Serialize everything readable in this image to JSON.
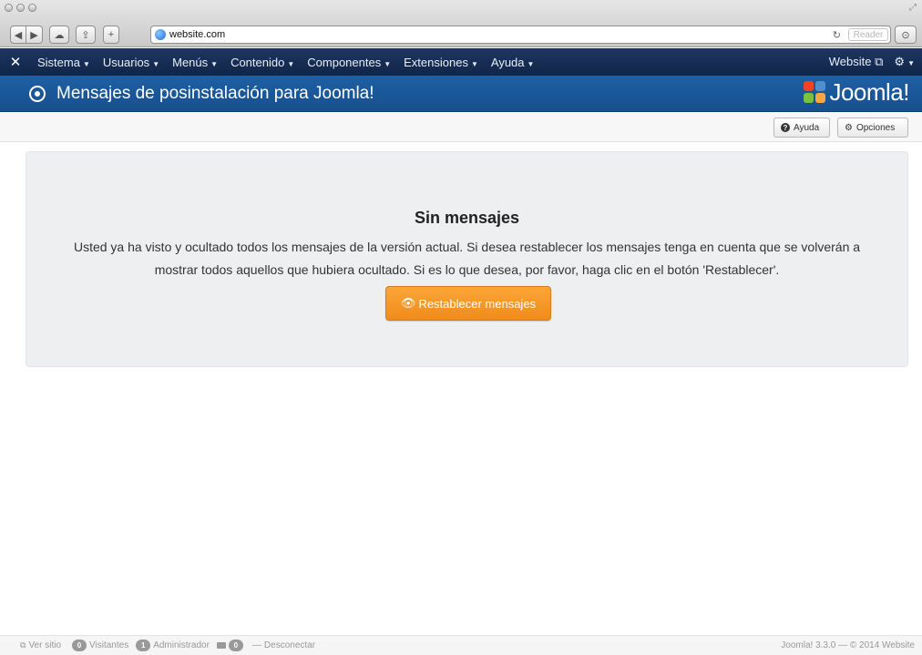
{
  "browser": {
    "url": "website.com",
    "reader_label": "Reader"
  },
  "nav": {
    "items": [
      {
        "label": "Sistema"
      },
      {
        "label": "Usuarios"
      },
      {
        "label": "Menús"
      },
      {
        "label": "Contenido"
      },
      {
        "label": "Componentes"
      },
      {
        "label": "Extensiones"
      },
      {
        "label": "Ayuda"
      }
    ],
    "website_label": "Website"
  },
  "header": {
    "title": "Mensajes de posinstalación para Joomla!",
    "logo_text": "Joomla!"
  },
  "toolbar": {
    "help_label": "Ayuda",
    "options_label": "Opciones"
  },
  "message": {
    "title": "Sin mensajes",
    "body": "Usted ya ha visto y ocultado todos los mensajes de la versión actual. Si desea restablecer los mensajes tenga en cuenta que se volverán a mostrar todos aquellos que hubiera ocultado. Si es lo que desea, por favor, haga clic en el botón 'Restablecer'.",
    "button_label": "Restablecer mensajes"
  },
  "status": {
    "view_site": "Ver sitio",
    "visitors_count": "0",
    "visitors_label": "Visitantes",
    "admins_count": "1",
    "admins_label": "Administrador",
    "messages_count": "0",
    "logout_label": "Desconectar",
    "copyright": "Joomla! 3.3.0 — © 2014 Website"
  },
  "colors": {
    "nav_bg": "#1a2f57",
    "title_bg": "#1b5a9e",
    "accent_orange": "#f59b2a"
  }
}
